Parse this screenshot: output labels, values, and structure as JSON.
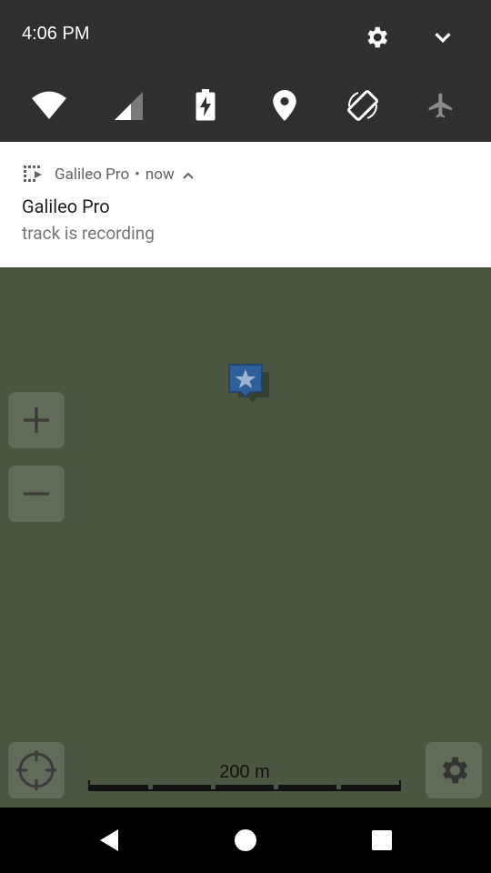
{
  "status_bar": {
    "time": "4:06 PM",
    "icons": [
      "settings-icon",
      "chevron-down-icon"
    ]
  },
  "quick_settings": {
    "tiles": [
      {
        "name": "wifi-icon"
      },
      {
        "name": "cellular-signal-icon"
      },
      {
        "name": "battery-charging-icon"
      },
      {
        "name": "location-icon"
      },
      {
        "name": "auto-rotate-icon"
      },
      {
        "name": "airplane-mode-icon"
      }
    ]
  },
  "notification": {
    "app_name": "Galileo Pro",
    "separator": "•",
    "time": "now",
    "title": "Galileo Pro",
    "text": "track is recording"
  },
  "map": {
    "scale_label": "200 m",
    "marker": "star-marker-icon",
    "colors": {
      "background": "#4a5641",
      "marker": "#2f5f9a"
    }
  },
  "nav_bar": {
    "buttons": [
      "back-icon",
      "home-icon",
      "recents-icon"
    ]
  }
}
